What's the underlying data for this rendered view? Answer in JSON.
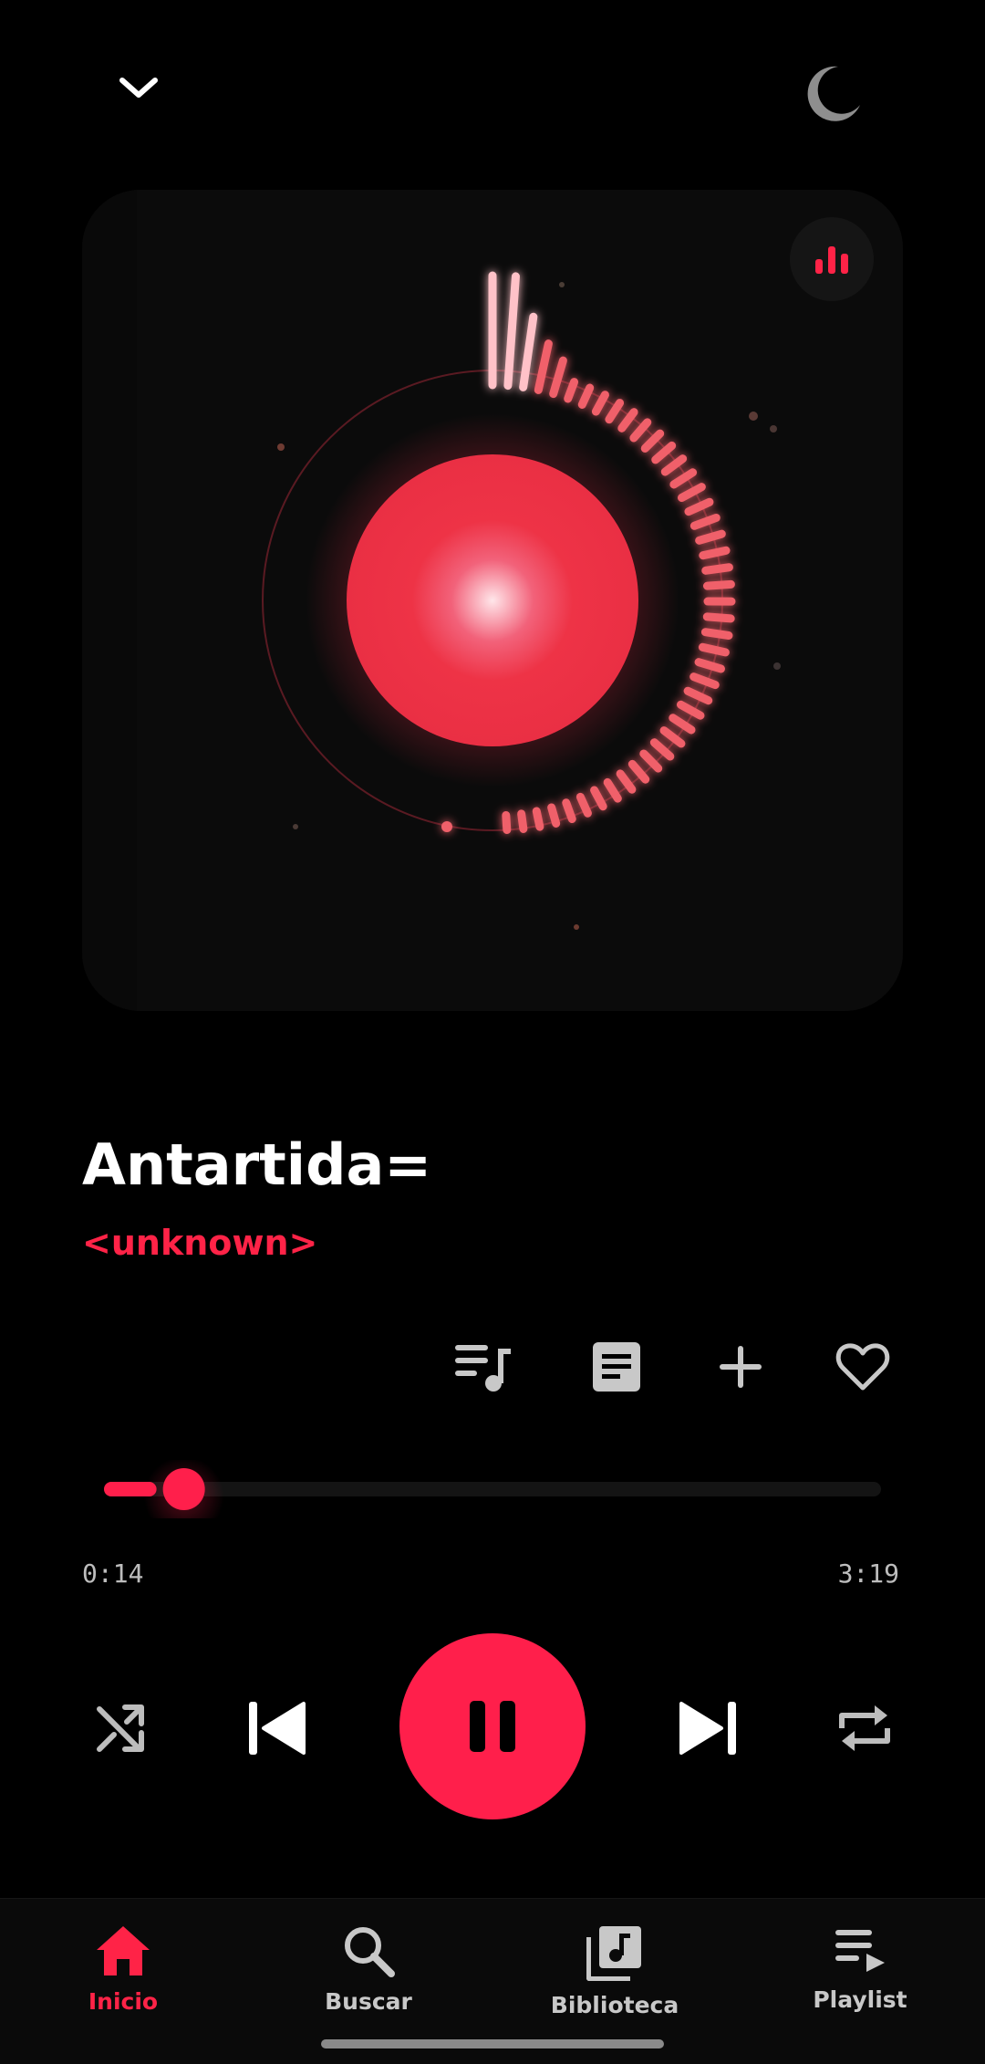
{
  "header": {
    "collapse_icon": "chevron-down-icon",
    "theme_icon": "moon-icon"
  },
  "visualizer": {
    "style_icon": "equalizer-bars-icon",
    "accent_color": "#ff2347",
    "disc_color": "#ee3346"
  },
  "track": {
    "title": "Antartida=",
    "artist": "<unknown>"
  },
  "actions": {
    "queue_icon": "queue-music-icon",
    "lyrics_icon": "lyrics-icon",
    "add_icon": "plus-icon",
    "favorite_icon": "heart-icon"
  },
  "progress": {
    "elapsed": "0:14",
    "duration": "3:19",
    "fraction": 0.07
  },
  "controls": {
    "shuffle_icon": "shuffle-icon",
    "previous_icon": "skip-previous-icon",
    "play_pause_icon": "pause-icon",
    "next_icon": "skip-next-icon",
    "repeat_icon": "repeat-icon"
  },
  "nav": {
    "items": [
      {
        "label": "Inicio",
        "icon": "home-icon",
        "active": true
      },
      {
        "label": "Buscar",
        "icon": "search-icon",
        "active": false
      },
      {
        "label": "Biblioteca",
        "icon": "library-music-icon",
        "active": false
      },
      {
        "label": "Playlist",
        "icon": "playlist-icon",
        "active": false
      }
    ]
  },
  "colors": {
    "background": "#000000",
    "accent": "#ff1f4b",
    "muted_icon": "#c8c8c8"
  }
}
